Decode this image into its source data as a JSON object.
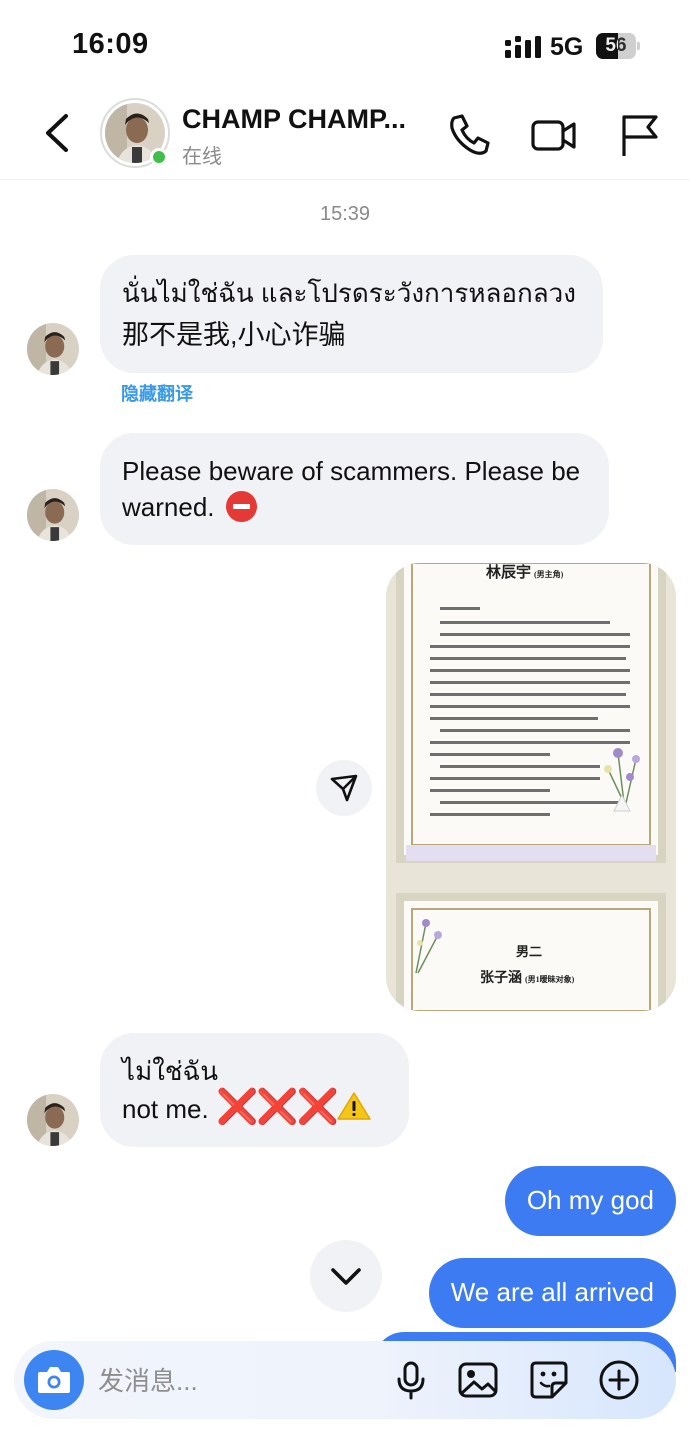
{
  "status_bar": {
    "time": "16:09",
    "network": "5G",
    "battery_level": "56",
    "battery_fraction": 0.56
  },
  "header": {
    "contact_name": "CHAMP CHAMP...",
    "contact_status": "在线"
  },
  "conversation": {
    "timestamp": "15:39",
    "message_1": {
      "original": "นั่นไม่ใช่ฉัน และโปรดระวังการหลอกลวง",
      "translation": "那不是我,小心诈骗",
      "hide_translation_label": "隐藏翻译"
    },
    "message_2": {
      "text": "Please beware of scammers. Please be warned."
    },
    "image": {
      "page1_title": "林辰宇",
      "page1_subtitle": "(男主角)",
      "page2_line1": "男二",
      "page2_title": "张子涵",
      "page2_subtitle": "(男1暧昧对象)"
    },
    "message_3": {
      "line1": "ไม่ใช่ฉัน",
      "line2": "not me.",
      "marks": "❌❌❌"
    },
    "outgoing": [
      {
        "text": "Oh my god"
      },
      {
        "text": "We are all arrived"
      }
    ]
  },
  "composer": {
    "placeholder": "发消息..."
  },
  "colors": {
    "outgoing_bubble": "#3d7bf2",
    "incoming_bubble": "#f1f2f6",
    "online_dot": "#3ec04a",
    "link": "#3a9ae8"
  }
}
